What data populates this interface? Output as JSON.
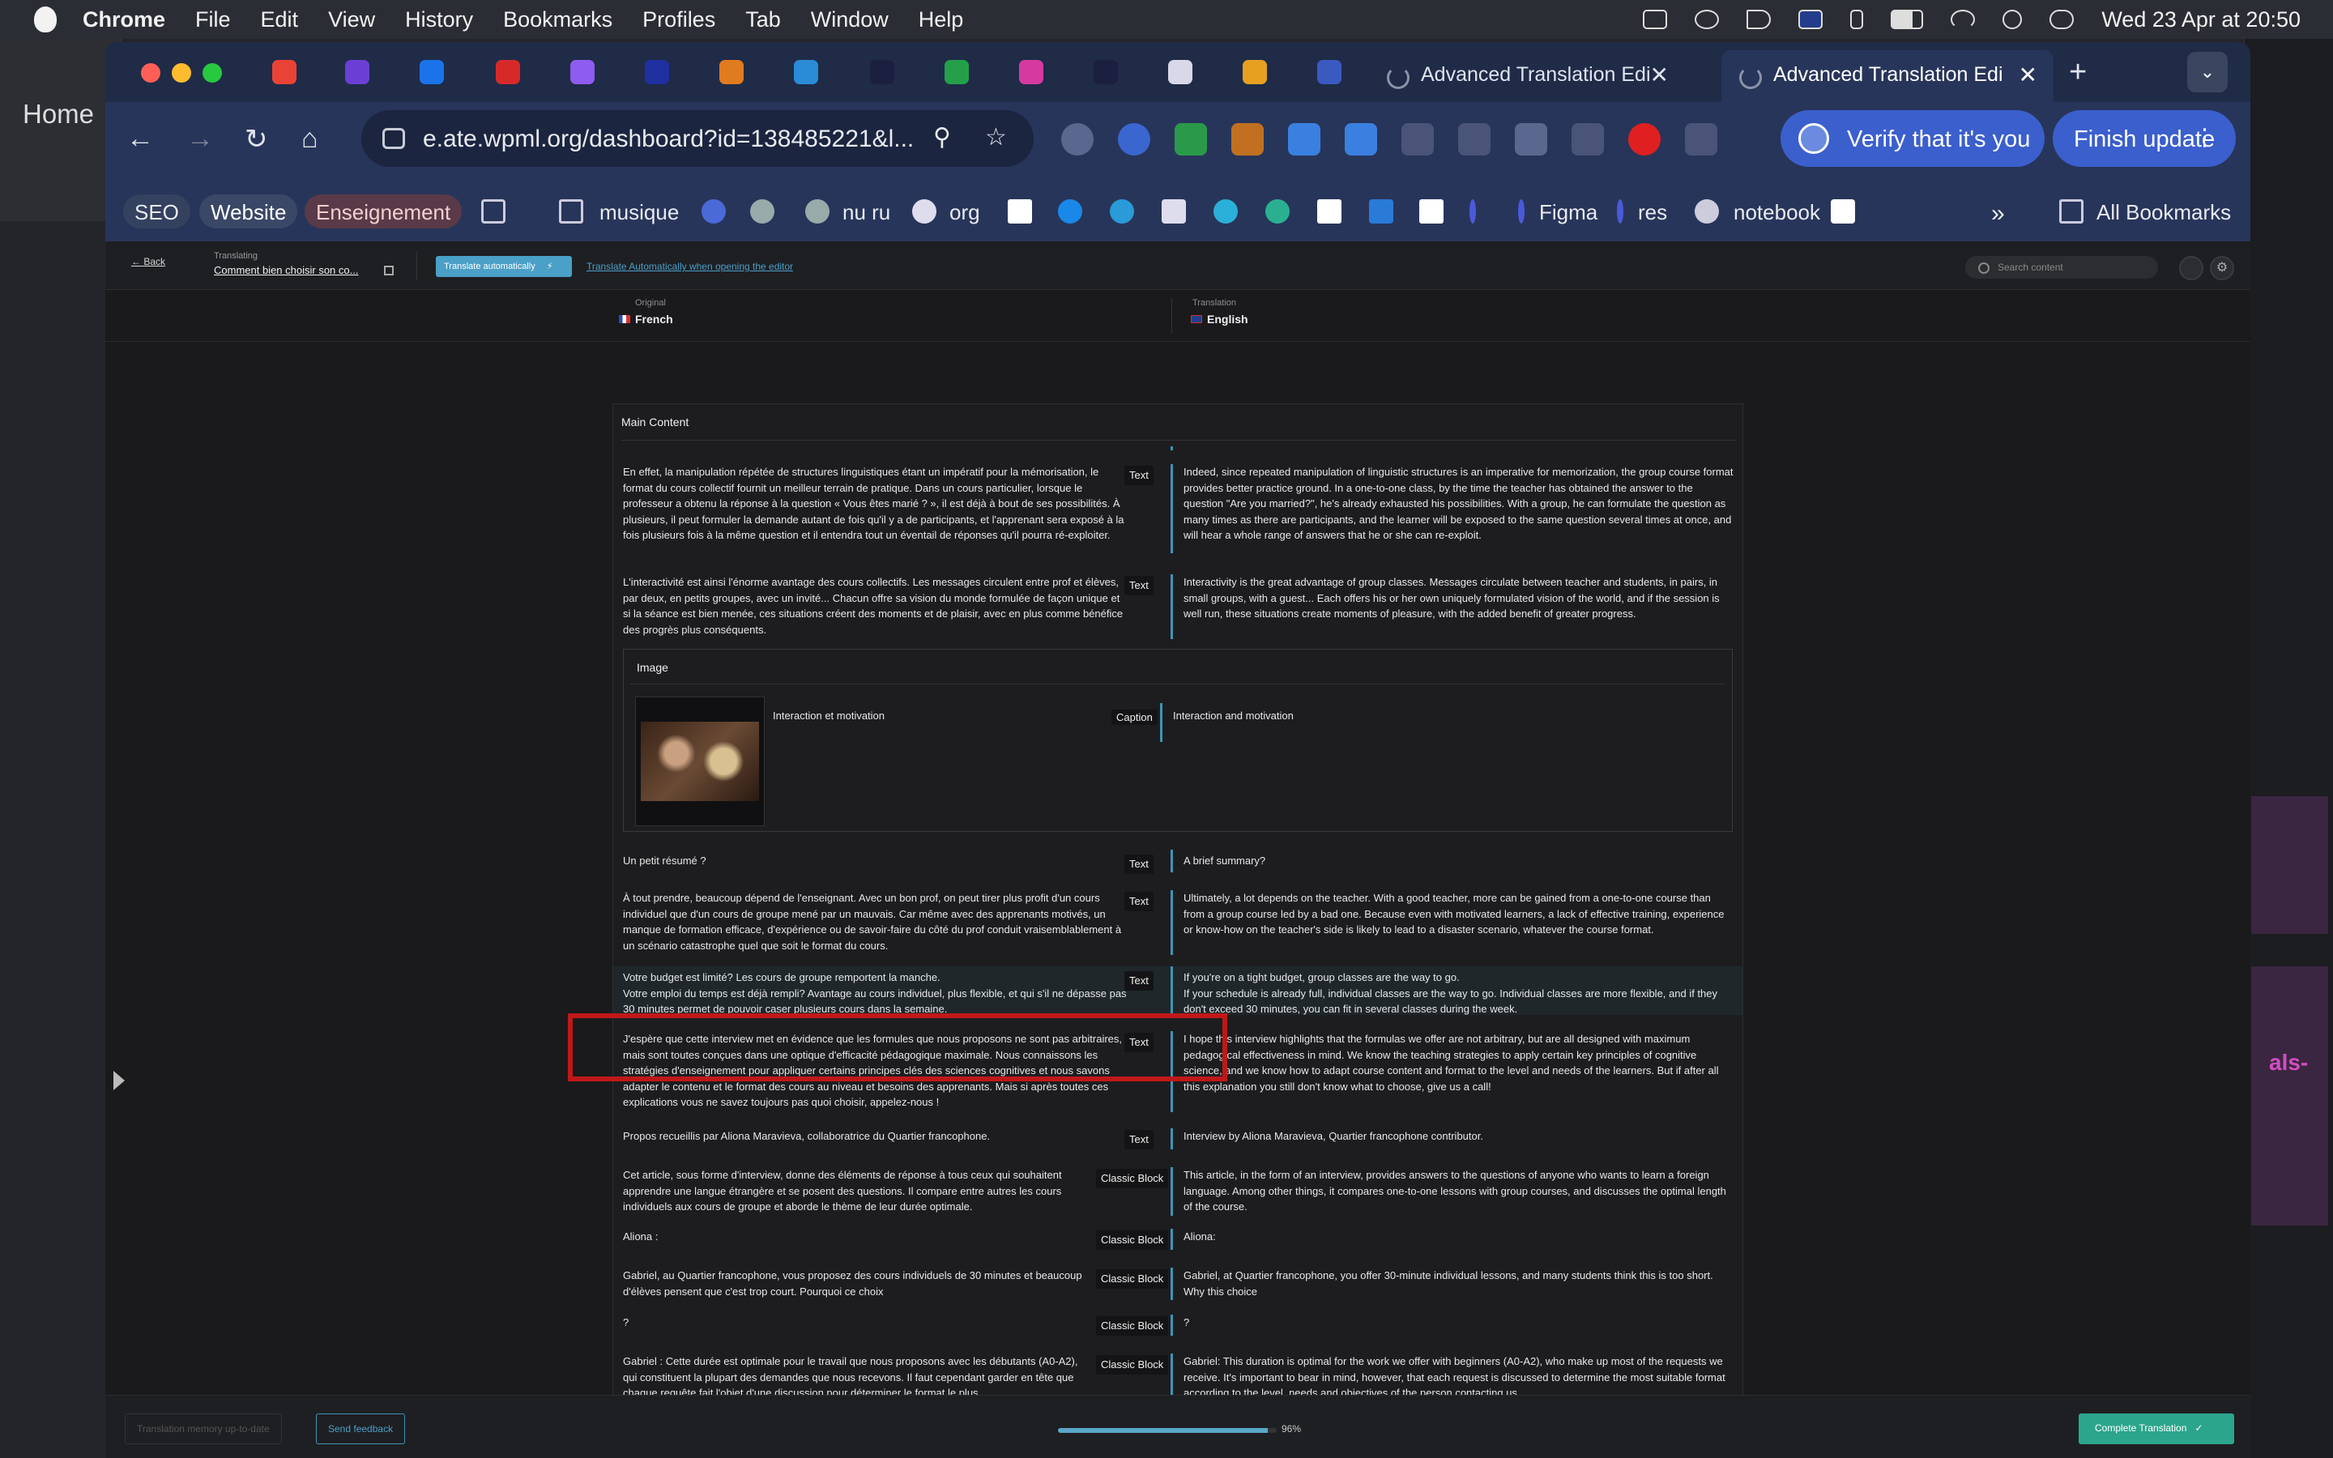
{
  "menubar": {
    "app": "Chrome",
    "items": [
      "File",
      "Edit",
      "View",
      "History",
      "Bookmarks",
      "Profiles",
      "Tab",
      "Window",
      "Help"
    ],
    "datetime": "Wed 23 Apr at  20:50"
  },
  "background_app": {
    "home": "Home",
    "pink_text": "als-"
  },
  "tabs": [
    {
      "title": "Advanced Translation Edi"
    },
    {
      "title": "Advanced Translation Edi"
    }
  ],
  "toolbar": {
    "url": "e.ate.wpml.org/dashboard?id=138485221&l...",
    "verify": "Verify that it's you",
    "finish": "Finish update"
  },
  "bookmarks": {
    "items": [
      "SEO",
      "Website",
      "Enseignement",
      "musique",
      "nu ru",
      "org",
      "Figma",
      "res",
      "notebook"
    ],
    "all": "All Bookmarks"
  },
  "ate": {
    "back": "Back",
    "translating_label": "Translating",
    "translating_title": "Comment bien choisir son co...",
    "translate_auto": "Translate automatically",
    "translate_auto_link": "Translate Automatically when opening the editor",
    "search_placeholder": "Search content"
  },
  "languages": {
    "original_label": "Original",
    "original": "French",
    "translation_label": "Translation",
    "translation": "English"
  },
  "section": "Main Content",
  "rows": [
    {
      "src": "En effet, la manipulation répétée de structures linguistiques étant un impératif pour la mémorisation, le format du cours collectif fournit un meilleur terrain de pratique. Dans un cours particulier, lorsque le professeur a obtenu la réponse à la question « Vous êtes marié ? », il est déjà à bout de ses possibilités. À plusieurs, il peut formuler la demande autant de fois qu'il y a de participants, et l'apprenant sera exposé à la fois plusieurs fois à la même question et il entendra tout un éventail de réponses qu'il pourra ré-exploiter.",
      "type": "Text",
      "tgt": "Indeed, since repeated manipulation of linguistic structures is an imperative for memorization, the group course format provides better practice ground. In a one-to-one class, by the time the teacher has obtained the answer to the question \"Are you married?\", he's already exhausted his possibilities. With a group, he can formulate the question as many times as there are participants, and the learner will be exposed to the same question several times at once, and will hear a whole range of answers that he or she can re-exploit."
    },
    {
      "src": "L'interactivité est ainsi l'énorme avantage des cours collectifs. Les messages circulent entre prof et élèves, par deux, en petits groupes, avec un invité... Chacun offre sa vision du monde formulée de façon unique et si la séance est bien menée, ces situations créent des moments et de plaisir, avec en plus comme bénéfice des progrès plus conséquents.",
      "type": "Text",
      "tgt": "Interactivity is the great advantage of group classes. Messages circulate between teacher and students, in pairs, in small groups, with a guest... Each offers his or her own uniquely formulated vision of the world, and if the session is well run, these situations create moments of pleasure, with the added benefit of greater progress."
    },
    {
      "src": "Un petit résumé ?",
      "type": "Text",
      "tgt": "A brief summary?"
    },
    {
      "src": "À tout prendre, beaucoup dépend de l'enseignant. Avec un bon prof, on peut tirer plus profit d'un cours individuel que d'un cours de groupe mené par un mauvais. Car même avec des apprenants motivés, un manque de formation efficace, d'expérience ou de savoir-faire du côté du prof conduit vraisemblablement à un scénario catastrophe quel que soit le format du cours.",
      "type": "Text",
      "tgt": "Ultimately, a lot depends on the teacher. With a good teacher, more can be gained from a one-to-one course than from a group course led by a bad one. Because even with motivated learners, a lack of effective training, experience or know-how on the teacher's side is likely to lead to a disaster scenario, whatever the course format."
    },
    {
      "src": "Votre budget est limité? Les cours de groupe remportent la manche.\nVotre emploi du temps est déjà rempli? Avantage au cours individuel, plus flexible, et qui s'il ne dépasse pas 30 minutes permet de pouvoir caser plusieurs cours dans la semaine.",
      "type": "Text",
      "tgt": "If you're on a tight budget, group classes are the way to go.\nIf your schedule is already full, individual classes are the way to go. Individual classes are more flexible, and if they don't exceed 30 minutes, you can fit in several classes during the week."
    },
    {
      "src": "J'espère que cette interview met en évidence que les formules que nous proposons ne sont pas arbitraires, mais sont toutes conçues dans une optique d'efficacité pédagogique maximale. Nous connaissons les stratégies d'enseignement pour appliquer certains principes clés des sciences cognitives et nous savons adapter le contenu et le format des cours au niveau et besoins des apprenants. Mais si après toutes ces explications vous ne savez toujours pas quoi choisir, appelez-nous !",
      "type": "Text",
      "tgt": "I hope this interview highlights that the formulas we offer are not arbitrary, but are all designed with maximum pedagogical effectiveness in mind. We know the teaching strategies to apply certain key principles of cognitive science, and we know how to adapt course content and format to the level and needs of the learners. But if after all this explanation you still don't know what to choose, give us a call!"
    },
    {
      "src": "Propos recueillis par Aliona Maravieva, collaboratrice du Quartier francophone.",
      "type": "Text",
      "tgt": "Interview by Aliona Maravieva, Quartier francophone contributor."
    },
    {
      "src": "Cet article, sous forme d'interview, donne des éléments de réponse à tous ceux qui souhaitent apprendre une langue étrangère et se posent des questions. Il compare entre autres les cours individuels aux cours de groupe et aborde le thème de leur durée optimale.",
      "type": "Classic Block",
      "tgt": "This article, in the form of an interview, provides answers to the questions of anyone who wants to learn a foreign language. Among other things, it compares one-to-one lessons with group courses, and discusses the optimal length of the course."
    },
    {
      "src": "Aliona :",
      "type": "Classic Block",
      "tgt": "Aliona:"
    },
    {
      "src": "Gabriel, au Quartier francophone, vous proposez des cours individuels de 30 minutes et beaucoup d'élèves pensent que c'est trop court. Pourquoi ce choix",
      "type": "Classic Block",
      "tgt": "Gabriel, at Quartier francophone, you offer 30-minute individual lessons, and many students think this is too short. Why this choice"
    },
    {
      "src": "?",
      "type": "Classic Block",
      "tgt": "?"
    },
    {
      "src": "Gabriel : Cette durée est optimale pour le travail que nous proposons avec les débutants (A0-A2), qui constituent la plupart des demandes que nous recevons. Il faut cependant garder en tête que chaque requête fait l'objet d'une discussion pour déterminer le format le plus",
      "type": "Classic Block",
      "tgt": "Gabriel: This duration is optimal for the work we offer with beginners (A0-A2), who make up most of the requests we receive. It's important to bear in mind, however, that each request is discussed to determine the most suitable format according to the level, needs and objectives of the person contacting us."
    }
  ],
  "image_block": {
    "title": "Image",
    "caption_src": "Interaction et motivation",
    "type": "Caption",
    "caption_tgt": "Interaction and motivation"
  },
  "footer": {
    "tm": "Translation memory up-to-date",
    "feedback": "Send feedback",
    "progress": 0.96,
    "progress_label": "96%",
    "complete": "Complete Translation"
  }
}
